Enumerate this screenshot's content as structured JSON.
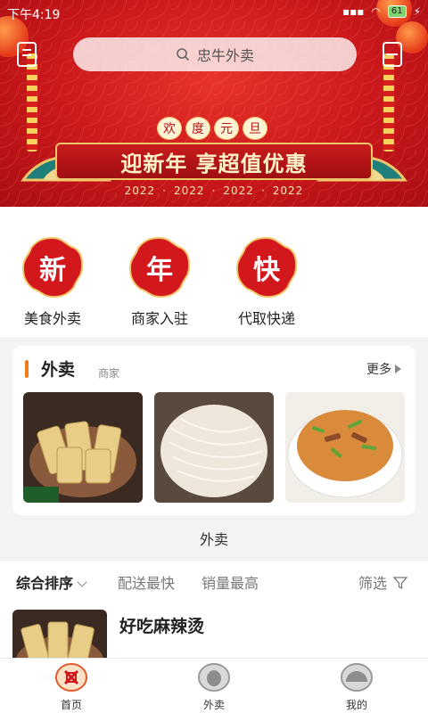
{
  "status_bar": {
    "time": "下午4:19",
    "battery": "61"
  },
  "search": {
    "placeholder": "忠牛外卖"
  },
  "banner": {
    "tag_chars": [
      "欢",
      "度",
      "元",
      "旦"
    ],
    "headline": "迎新年 享超值优惠",
    "years": [
      "2022",
      "2022",
      "2022",
      "2022"
    ]
  },
  "shortcuts": [
    {
      "char": "新",
      "label": "美食外卖"
    },
    {
      "char": "年",
      "label": "商家入驻"
    },
    {
      "char": "快",
      "label": "代取快递"
    }
  ],
  "takeout_card": {
    "title": "外卖",
    "subtitle": "商家",
    "more": "更多",
    "caption": "外卖"
  },
  "sort": {
    "items": [
      "综合排序",
      "配送最快",
      "销量最高"
    ],
    "filter": "筛选"
  },
  "shop": {
    "name": "好吃麻辣烫"
  },
  "tabs": [
    {
      "label": "首页"
    },
    {
      "label": "外卖"
    },
    {
      "label": "我的"
    }
  ],
  "colors": {
    "brand_red": "#c9171b",
    "accent_orange": "#f07a1a",
    "teal_fan": "#1f7f7a"
  }
}
